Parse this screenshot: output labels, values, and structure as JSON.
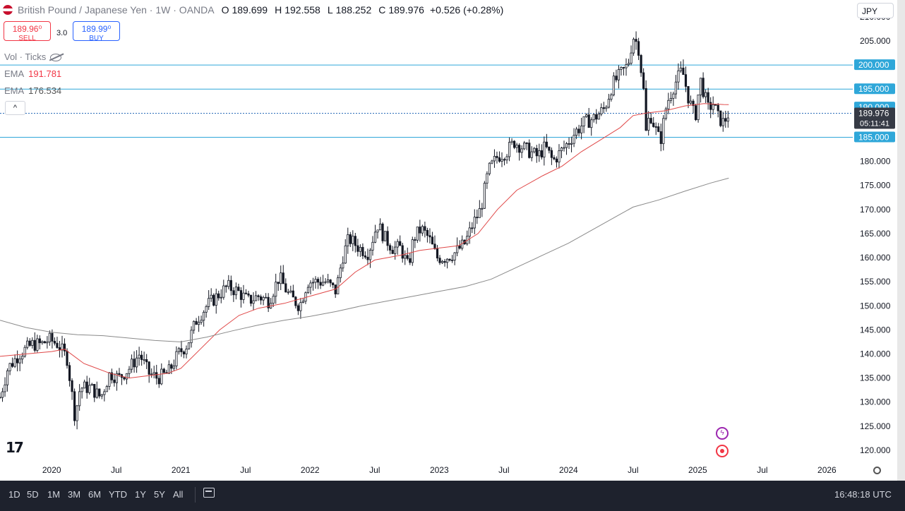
{
  "header": {
    "symbol": "British Pound / Japanese Yen · 1W · OANDA",
    "o_label": "O",
    "o_value": "189.699",
    "h_label": "H",
    "h_value": "192.558",
    "l_label": "L",
    "l_value": "188.252",
    "c_label": "C",
    "c_value": "189.976",
    "change": "+0.526 (+0.28%)"
  },
  "trade": {
    "sell_price": "189.96⁰",
    "sell_label": "SELL",
    "spread": "3.0",
    "buy_price": "189.99⁰",
    "buy_label": "BUY"
  },
  "indicators": {
    "vol_label": "Vol · Ticks",
    "ema1_label": "EMA",
    "ema1_value": "191.781",
    "ema2_label": "EMA",
    "ema2_value": "176.534",
    "collapse": "^"
  },
  "currency_button": "JPY",
  "timeframes": [
    "1D",
    "5D",
    "1M",
    "3M",
    "6M",
    "YTD",
    "1Y",
    "5Y",
    "All"
  ],
  "clock": "16:48:18 UTC",
  "logo_text": "17",
  "colors": {
    "up": "#131722",
    "down": "#131722",
    "ema_fast": "#e04848",
    "ema_slow": "#8a8a8a",
    "hline": "#2fa7d9",
    "label_bg": "#2fa7d9",
    "price_label_bg": "#363a45"
  },
  "icons": [
    "flash-icon",
    "target-icon",
    "gear-icon",
    "calendar-icon",
    "eye-off-icon"
  ],
  "chart_data": {
    "type": "candlestick",
    "y_ticks": [
      210,
      205,
      200,
      195,
      190,
      185,
      180,
      175,
      170,
      165,
      160,
      155,
      150,
      145,
      140,
      135,
      130,
      125,
      120
    ],
    "y_tick_labels": [
      "210.000",
      "205.000",
      "200.000",
      "195.000",
      "190.000",
      "185.000",
      "180.000",
      "175.000",
      "170.000",
      "165.000",
      "160.000",
      "155.000",
      "150.000",
      "145.000",
      "140.000",
      "135.000",
      "130.000",
      "125.000",
      "120.000"
    ],
    "x_ticks": [
      {
        "t": 2020.0,
        "label": "2020"
      },
      {
        "t": 2020.5,
        "label": "Jul"
      },
      {
        "t": 2021.0,
        "label": "2021"
      },
      {
        "t": 2021.5,
        "label": "Jul"
      },
      {
        "t": 2022.0,
        "label": "2022"
      },
      {
        "t": 2022.5,
        "label": "Jul"
      },
      {
        "t": 2023.0,
        "label": "2023"
      },
      {
        "t": 2023.5,
        "label": "Jul"
      },
      {
        "t": 2024.0,
        "label": "2024"
      },
      {
        "t": 2024.5,
        "label": "Jul"
      },
      {
        "t": 2025.0,
        "label": "2025"
      },
      {
        "t": 2025.5,
        "label": "Jul"
      },
      {
        "t": 2026.0,
        "label": "2026"
      }
    ],
    "x_range": [
      2019.6,
      2026.2
    ],
    "y_range": [
      117.5,
      213.5
    ],
    "price_path": [
      [
        2019.6,
        131
      ],
      [
        2019.66,
        137
      ],
      [
        2019.75,
        140
      ],
      [
        2019.85,
        142
      ],
      [
        2019.92,
        142
      ],
      [
        2019.98,
        143
      ],
      [
        2020.05,
        142
      ],
      [
        2020.12,
        139
      ],
      [
        2020.18,
        127
      ],
      [
        2020.22,
        133
      ],
      [
        2020.3,
        133
      ],
      [
        2020.38,
        131
      ],
      [
        2020.45,
        136
      ],
      [
        2020.52,
        135
      ],
      [
        2020.6,
        137
      ],
      [
        2020.68,
        140
      ],
      [
        2020.75,
        136
      ],
      [
        2020.82,
        135
      ],
      [
        2020.9,
        136
      ],
      [
        2020.98,
        140
      ],
      [
        2021.05,
        142
      ],
      [
        2021.12,
        147
      ],
      [
        2021.2,
        150
      ],
      [
        2021.28,
        152
      ],
      [
        2021.36,
        154
      ],
      [
        2021.44,
        153
      ],
      [
        2021.52,
        151
      ],
      [
        2021.6,
        152
      ],
      [
        2021.68,
        151
      ],
      [
        2021.76,
        156
      ],
      [
        2021.84,
        152
      ],
      [
        2021.92,
        150
      ],
      [
        2021.98,
        155
      ],
      [
        2022.05,
        155
      ],
      [
        2022.12,
        155
      ],
      [
        2022.2,
        153
      ],
      [
        2022.25,
        160
      ],
      [
        2022.3,
        164
      ],
      [
        2022.38,
        162
      ],
      [
        2022.45,
        161
      ],
      [
        2022.52,
        167
      ],
      [
        2022.58,
        164
      ],
      [
        2022.64,
        162
      ],
      [
        2022.7,
        162
      ],
      [
        2022.76,
        158
      ],
      [
        2022.8,
        164
      ],
      [
        2022.86,
        166
      ],
      [
        2022.92,
        164
      ],
      [
        2022.98,
        160
      ],
      [
        2023.05,
        160
      ],
      [
        2023.12,
        161
      ],
      [
        2023.2,
        163
      ],
      [
        2023.26,
        167
      ],
      [
        2023.32,
        170
      ],
      [
        2023.38,
        178
      ],
      [
        2023.45,
        181
      ],
      [
        2023.52,
        182
      ],
      [
        2023.58,
        184
      ],
      [
        2023.64,
        183
      ],
      [
        2023.7,
        182
      ],
      [
        2023.76,
        181
      ],
      [
        2023.82,
        183
      ],
      [
        2023.88,
        180
      ],
      [
        2023.94,
        182
      ],
      [
        2024.0,
        184
      ],
      [
        2024.05,
        186
      ],
      [
        2024.12,
        188
      ],
      [
        2024.2,
        189
      ],
      [
        2024.28,
        191
      ],
      [
        2024.34,
        196
      ],
      [
        2024.4,
        198
      ],
      [
        2024.46,
        200
      ],
      [
        2024.5,
        206
      ],
      [
        2024.54,
        204
      ],
      [
        2024.58,
        195
      ],
      [
        2024.6,
        186
      ],
      [
        2024.63,
        190
      ],
      [
        2024.67,
        187
      ],
      [
        2024.71,
        184
      ],
      [
        2024.76,
        192
      ],
      [
        2024.82,
        196
      ],
      [
        2024.88,
        199
      ],
      [
        2024.93,
        193
      ],
      [
        2024.98,
        189
      ],
      [
        2025.02,
        197
      ],
      [
        2025.08,
        191
      ],
      [
        2025.12,
        192
      ],
      [
        2025.16,
        189
      ],
      [
        2025.2,
        188
      ],
      [
        2025.24,
        190
      ]
    ],
    "ema_fast": [
      [
        2019.6,
        139.5
      ],
      [
        2019.8,
        140
      ],
      [
        2020.0,
        140.5
      ],
      [
        2020.1,
        141
      ],
      [
        2020.25,
        138
      ],
      [
        2020.45,
        136
      ],
      [
        2020.6,
        135
      ],
      [
        2020.75,
        135.5
      ],
      [
        2020.9,
        136
      ],
      [
        2021.0,
        137
      ],
      [
        2021.15,
        141
      ],
      [
        2021.3,
        145
      ],
      [
        2021.45,
        148
      ],
      [
        2021.6,
        149.5
      ],
      [
        2021.8,
        150.5
      ],
      [
        2022.0,
        152
      ],
      [
        2022.2,
        153.5
      ],
      [
        2022.35,
        157
      ],
      [
        2022.5,
        159.5
      ],
      [
        2022.7,
        160.5
      ],
      [
        2022.85,
        161.5
      ],
      [
        2023.0,
        162
      ],
      [
        2023.15,
        162.5
      ],
      [
        2023.3,
        165
      ],
      [
        2023.45,
        170
      ],
      [
        2023.6,
        174
      ],
      [
        2023.8,
        177
      ],
      [
        2023.95,
        179
      ],
      [
        2024.1,
        182
      ],
      [
        2024.25,
        184.5
      ],
      [
        2024.4,
        187
      ],
      [
        2024.5,
        189.5
      ],
      [
        2024.6,
        190
      ],
      [
        2024.75,
        190.5
      ],
      [
        2024.9,
        191.5
      ],
      [
        2025.05,
        192
      ],
      [
        2025.2,
        191.8
      ],
      [
        2025.24,
        191.78
      ]
    ],
    "ema_slow": [
      [
        2019.6,
        147
      ],
      [
        2019.8,
        145.5
      ],
      [
        2020.0,
        144.5
      ],
      [
        2020.2,
        144
      ],
      [
        2020.4,
        143.8
      ],
      [
        2020.6,
        143.3
      ],
      [
        2020.8,
        142.8
      ],
      [
        2021.0,
        142.5
      ],
      [
        2021.2,
        143.5
      ],
      [
        2021.4,
        144.8
      ],
      [
        2021.6,
        146
      ],
      [
        2021.8,
        147
      ],
      [
        2022.0,
        147.8
      ],
      [
        2022.2,
        148.8
      ],
      [
        2022.4,
        150
      ],
      [
        2022.6,
        151
      ],
      [
        2022.8,
        152
      ],
      [
        2023.0,
        153
      ],
      [
        2023.2,
        154
      ],
      [
        2023.4,
        155.5
      ],
      [
        2023.6,
        158
      ],
      [
        2023.8,
        160.5
      ],
      [
        2024.0,
        163
      ],
      [
        2024.2,
        166
      ],
      [
        2024.4,
        169
      ],
      [
        2024.5,
        170.5
      ],
      [
        2024.7,
        172
      ],
      [
        2024.9,
        173.8
      ],
      [
        2025.1,
        175.5
      ],
      [
        2025.24,
        176.5
      ]
    ],
    "hlines": [
      {
        "price": 200,
        "label": "200.000"
      },
      {
        "price": 195,
        "label": "195.000"
      },
      {
        "price": 185,
        "label": "185.000"
      }
    ],
    "current_price": {
      "price": 189.976,
      "label": "189.976",
      "timer": "05:11:41"
    },
    "extra_label": {
      "price": 190,
      "label": "190.000"
    }
  }
}
